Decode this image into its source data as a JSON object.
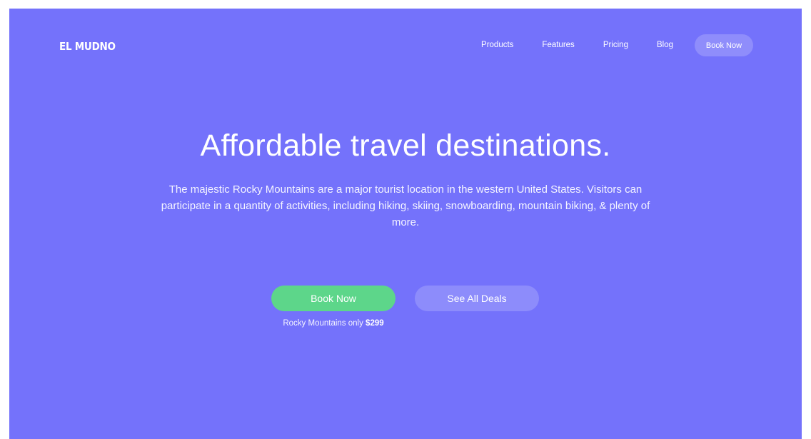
{
  "brand": {
    "logo_text": "EL MUDNO"
  },
  "nav": {
    "links": [
      "Products",
      "Features",
      "Pricing",
      "Blog"
    ],
    "cta_label": "Book Now"
  },
  "hero": {
    "headline": "Affordable travel destinations.",
    "description": "The majestic Rocky Mountains are a major tourist location in the western United States. Visitors can participate in a quantity of activities, including hiking, skiing, snowboarding, mountain biking, & plenty of more.",
    "primary_button": "Book Now",
    "secondary_button": "See All Deals",
    "price_note_prefix": "Rocky Mountains only",
    "price_note_price": "$299"
  },
  "colors": {
    "background": "#7472fb",
    "primary_button": "#5dd68a",
    "secondary_button": "#8d8cfb",
    "nav_cta": "#8f8dfb",
    "text": "#ffffff"
  }
}
